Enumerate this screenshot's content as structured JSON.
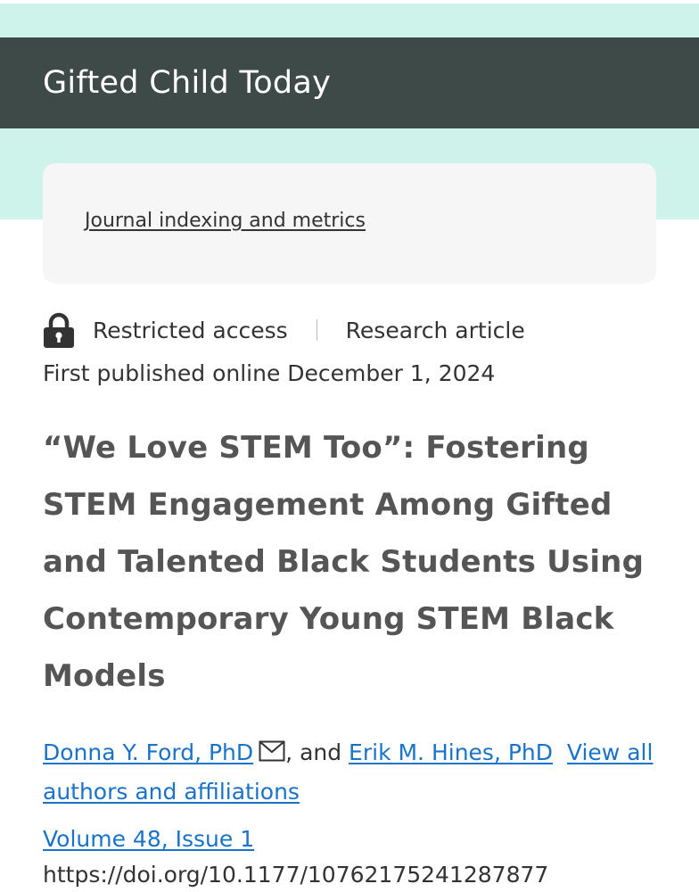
{
  "journal": {
    "title": "Gifted Child Today"
  },
  "indexing": {
    "link_label": "Journal indexing and metrics"
  },
  "article_meta": {
    "access": "Restricted access",
    "type": "Research article",
    "published": "First published online December 1, 2024"
  },
  "article": {
    "title": "“We Love STEM Too”: Fostering STEM Engagement Among Gifted and Talented Black Students Using Contemporary Young STEM Black Models"
  },
  "authors": {
    "author1": "Donna Y. Ford, PhD",
    "separator": ", and ",
    "author2": "Erik M. Hines, PhD",
    "view_all": "View all authors and affiliations"
  },
  "issue": {
    "volume": "Volume 48, Issue 1",
    "doi": "https://doi.org/10.1177/10762175241287877"
  },
  "icons": {
    "lock": "lock-icon",
    "mail": "mail-icon"
  },
  "colors": {
    "header_bg": "#3e4a47",
    "teal_band": "#cdf3ea",
    "link": "#1a73c9",
    "title_text": "#555555"
  }
}
